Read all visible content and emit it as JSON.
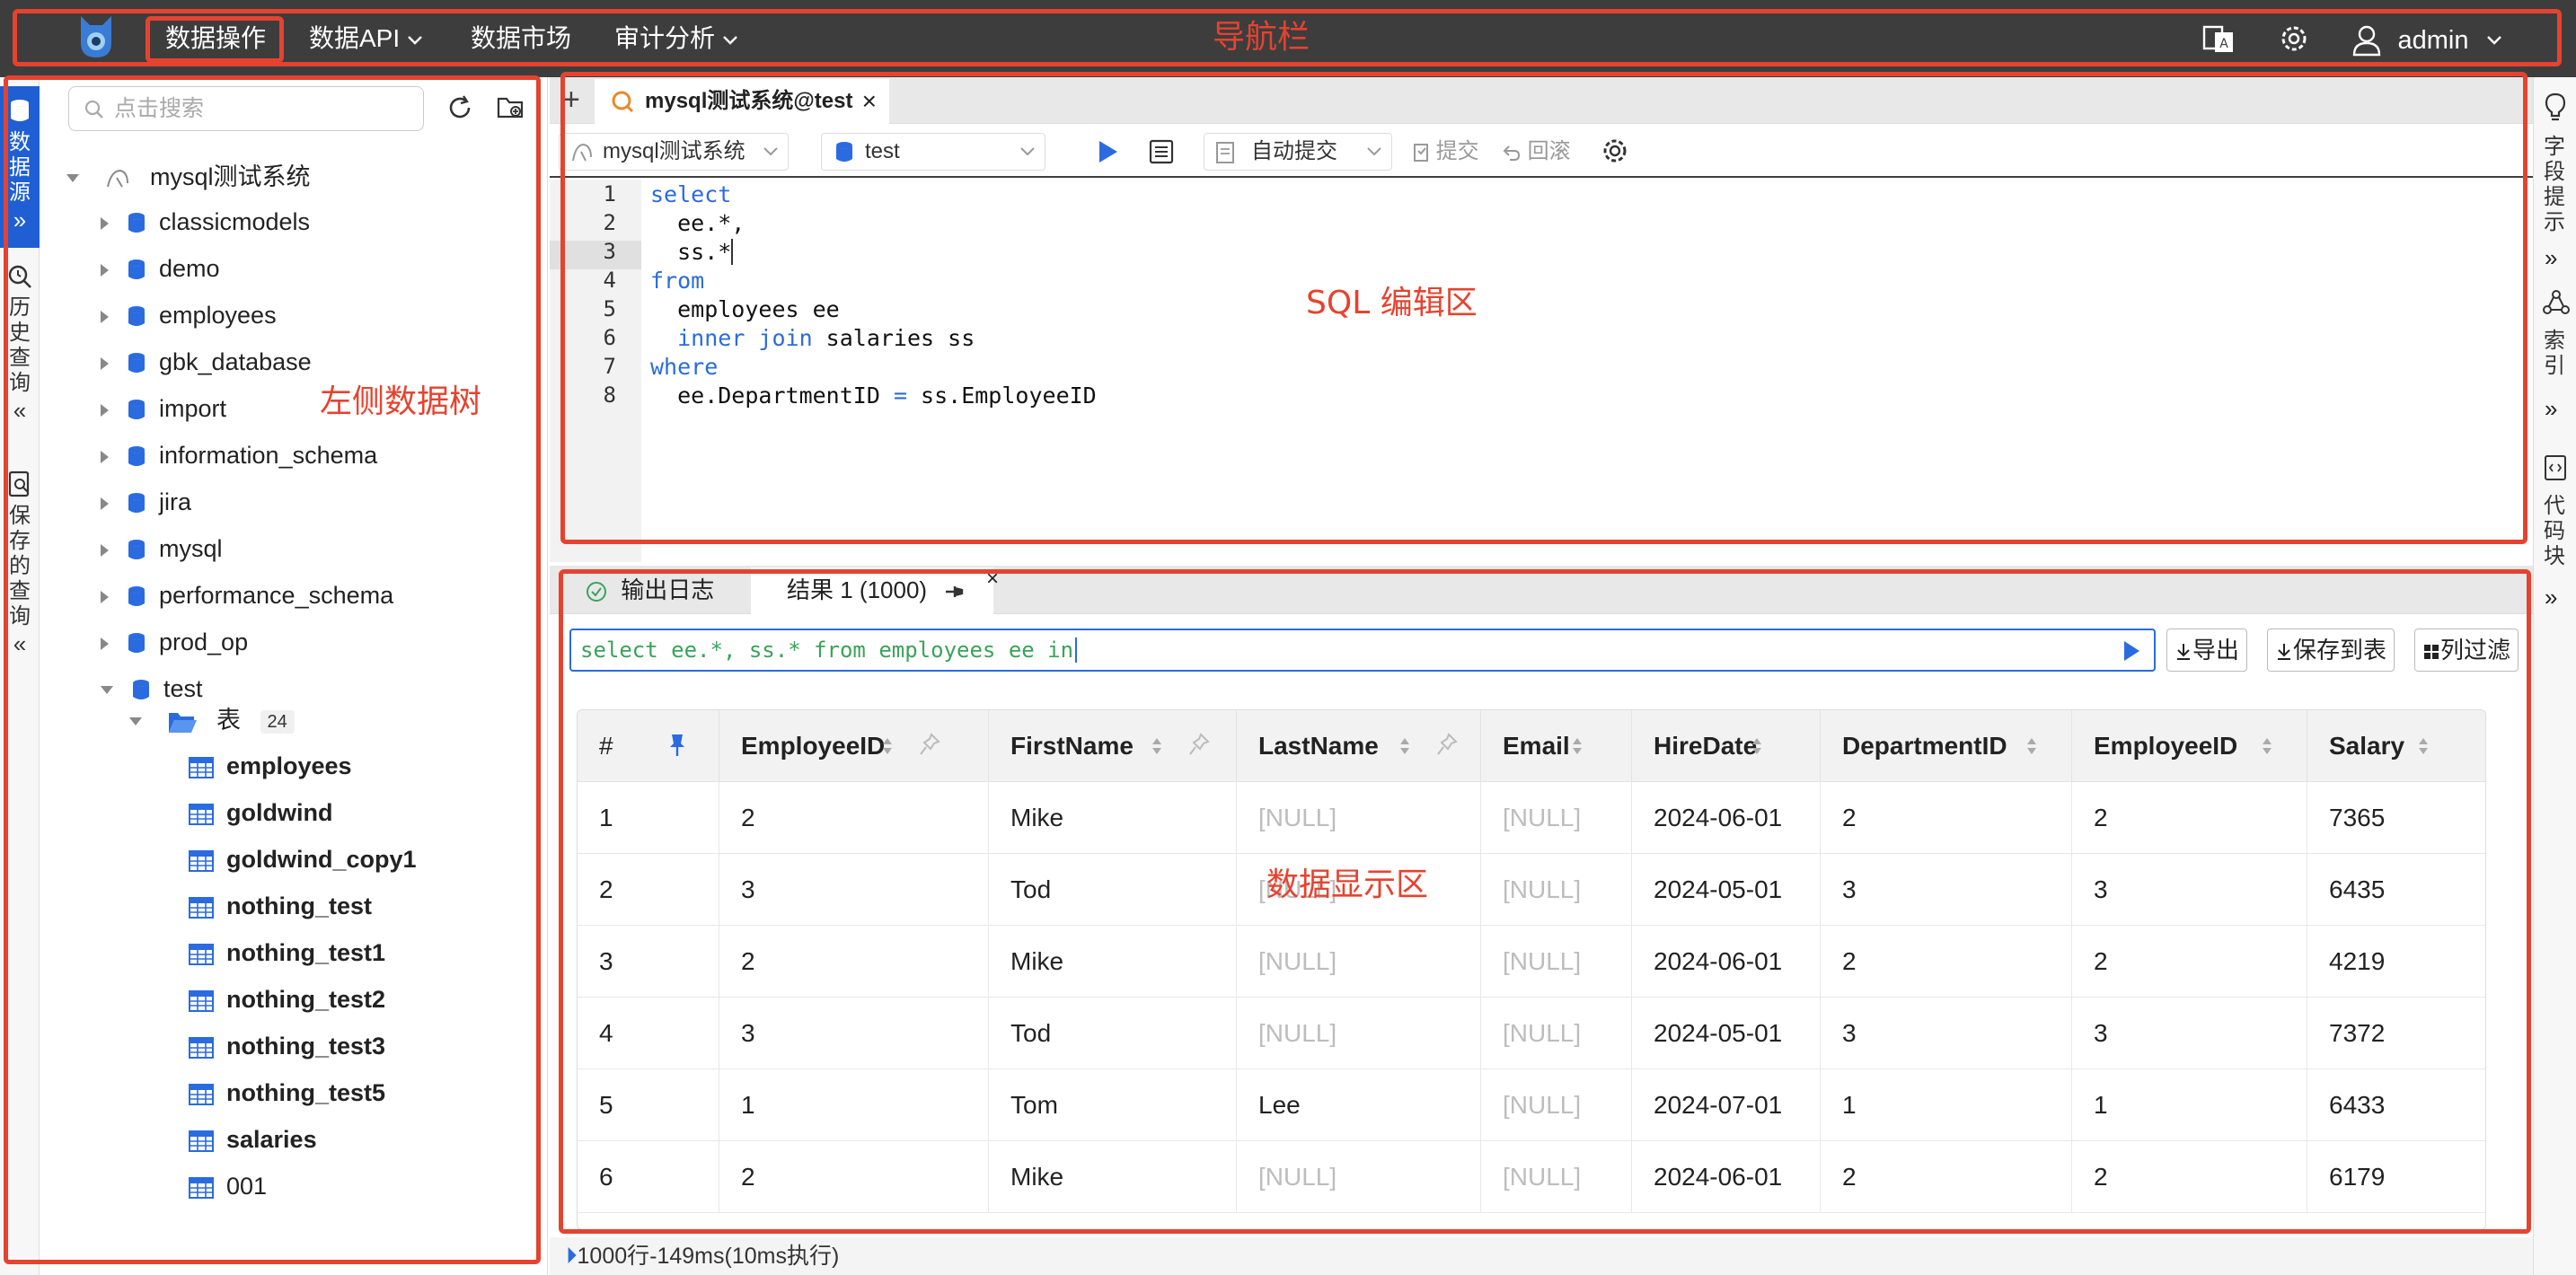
{
  "nav": {
    "items": [
      "数据操作",
      "数据API",
      "数据市场",
      "审计分析"
    ],
    "user": "admin"
  },
  "left_strip": {
    "tabs": [
      "数据源",
      "历史查询",
      "保存的查询"
    ]
  },
  "tree": {
    "search_placeholder": "点击搜索",
    "root": "mysql测试系统",
    "databases": [
      "classicmodels",
      "demo",
      "employees",
      "gbk_database",
      "import",
      "information_schema",
      "jira",
      "mysql",
      "performance_schema",
      "prod_op",
      "test"
    ],
    "table_group_label": "表",
    "table_count": "24",
    "tables": [
      "employees",
      "goldwind",
      "goldwind_copy1",
      "nothing_test",
      "nothing_test1",
      "nothing_test2",
      "nothing_test3",
      "nothing_test5",
      "salaries",
      "001"
    ]
  },
  "editor": {
    "tab_title": "mysql测试系统@test",
    "datasource": "mysql测试系统",
    "database": "test",
    "autocommit": "自动提交",
    "commit": "提交",
    "rollback": "回滚",
    "line_numbers": [
      "1",
      "2",
      "3",
      "4",
      "5",
      "6",
      "7",
      "8"
    ]
  },
  "results": {
    "tab_log": "输出日志",
    "tab_result": "结果 1 (1000)",
    "query_preview": "select ee.*, ss.* from employees ee in",
    "export": "导出",
    "save_to_table": "保存到表",
    "column_filter": "列过滤",
    "row_header": "#",
    "columns": [
      "EmployeeID",
      "FirstName",
      "LastName",
      "Email",
      "HireDate",
      "DepartmentID",
      "EmployeeID",
      "Salary"
    ],
    "rows": [
      [
        "1",
        "2",
        "Mike",
        "[NULL]",
        "[NULL]",
        "2024-06-01",
        "2",
        "2",
        "7365"
      ],
      [
        "2",
        "3",
        "Tod",
        "[NULL]",
        "[NULL]",
        "2024-05-01",
        "3",
        "3",
        "6435"
      ],
      [
        "3",
        "2",
        "Mike",
        "[NULL]",
        "[NULL]",
        "2024-06-01",
        "2",
        "2",
        "4219"
      ],
      [
        "4",
        "3",
        "Tod",
        "[NULL]",
        "[NULL]",
        "2024-05-01",
        "3",
        "3",
        "7372"
      ],
      [
        "5",
        "1",
        "Tom",
        "Lee",
        "[NULL]",
        "2024-07-01",
        "1",
        "1",
        "6433"
      ],
      [
        "6",
        "2",
        "Mike",
        "[NULL]",
        "[NULL]",
        "2024-06-01",
        "2",
        "2",
        "6179"
      ]
    ],
    "status": "1000行-149ms(10ms执行)"
  },
  "right_strip": {
    "tabs": [
      "字段提示",
      "索引",
      "代码块"
    ]
  },
  "annotations": {
    "nav": "导航栏",
    "tree": "左侧数据树",
    "editor": "SQL 编辑区",
    "results": "数据显示区"
  },
  "colors": {
    "nav_bg": "#3d3d3d",
    "accent": "#1f5fd3",
    "annotation": "#e5432f",
    "keyword": "#2a6be0",
    "null_text": "#bdbdbd"
  }
}
